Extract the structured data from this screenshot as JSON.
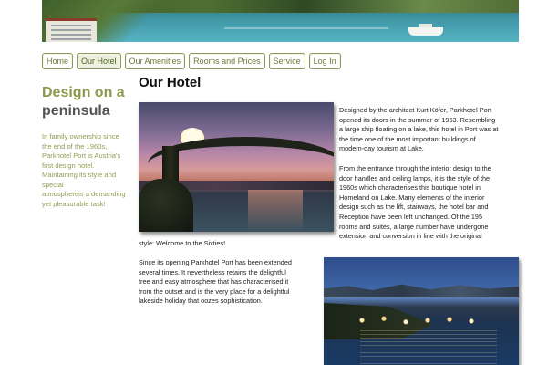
{
  "nav": {
    "tabs": [
      {
        "label": "Home"
      },
      {
        "label": "Our Hotel",
        "active": true
      },
      {
        "label": "Our Amenities"
      },
      {
        "label": "Rooms and Prices"
      },
      {
        "label": "Service"
      },
      {
        "label": "Log In"
      }
    ]
  },
  "sidebar": {
    "title_line1": "Design on a",
    "title_line2": "peninsula",
    "intro_lines": [
      "In family ownership since",
      "the end of the 1960s,",
      "Parkhotel Port is Austria's",
      "first design hotel.",
      "Maintaining its style and",
      "special",
      "atmosphereis a demanding",
      "yet pleasurable task!"
    ]
  },
  "main": {
    "title": "Our Hotel",
    "paragraph1_lines": [
      "Designed by the architect Kurt Köfer, Parkhotel Port",
      "opened its doors in the summer of 1963. Resembling",
      "a large ship floating on a lake, this hotel in Port was at",
      "the time one of the most important buildings of",
      "modern-day tourism at Lake."
    ],
    "paragraph2_lines": [
      "From the entrance through the interior design to the",
      "door handles and ceiling lamps, it is the style of the",
      "1960s which characterises this boutique hotel in",
      "Homeland on Lake. Many elements of the interior",
      "design such as the lift, stairways, the hotel bar and",
      "Reception have been left unchanged. Of the 195",
      "rooms and suites, a large number have undergone",
      "extension and conversion in line with the original"
    ],
    "paragraph2_continuation": "style: Welcome to the Sixties!",
    "paragraph3_lines": [
      "Since its opening Parkhotel Port has been extended",
      "several times. It nevertheless retains the delightful",
      "free and easy atmosphere that has characterised it",
      "from the outset and is the very place for a delightful",
      "lakeside holiday that oozes sophistication."
    ]
  }
}
